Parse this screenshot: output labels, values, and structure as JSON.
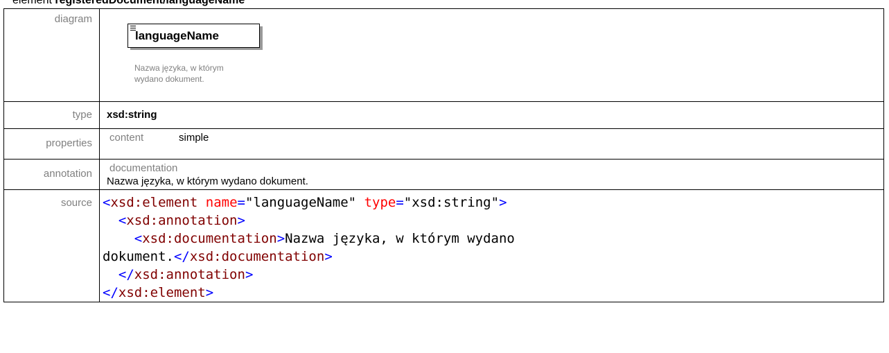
{
  "heading": {
    "prefix": "element ",
    "path": "registeredDocument/languageName"
  },
  "labels": {
    "diagram": "diagram",
    "type": "type",
    "properties": "properties",
    "annotation": "annotation",
    "source": "source"
  },
  "diagram": {
    "element_name": "languageName",
    "documentation_line1": "Nazwa języka, w którym",
    "documentation_line2": "wydano dokument."
  },
  "type_value": "xsd:string",
  "properties": {
    "key": "content",
    "value": "simple"
  },
  "annotation": {
    "key": "documentation",
    "text": "Nazwa języka, w którym wydano dokument."
  },
  "source": {
    "open_lt": "<",
    "el_tag": "xsd:element",
    "attr_name": "name",
    "eq": "=",
    "name_val": "\"languageName\"",
    "attr_type": "type",
    "type_val": "\"xsd:string\"",
    "gt": ">",
    "ann_tag": "xsd:annotation",
    "doc_tag": "xsd:documentation",
    "doc_text1": "Nazwa języka, w którym wydano",
    "doc_text2": "dokument.",
    "close_lt": "</"
  }
}
